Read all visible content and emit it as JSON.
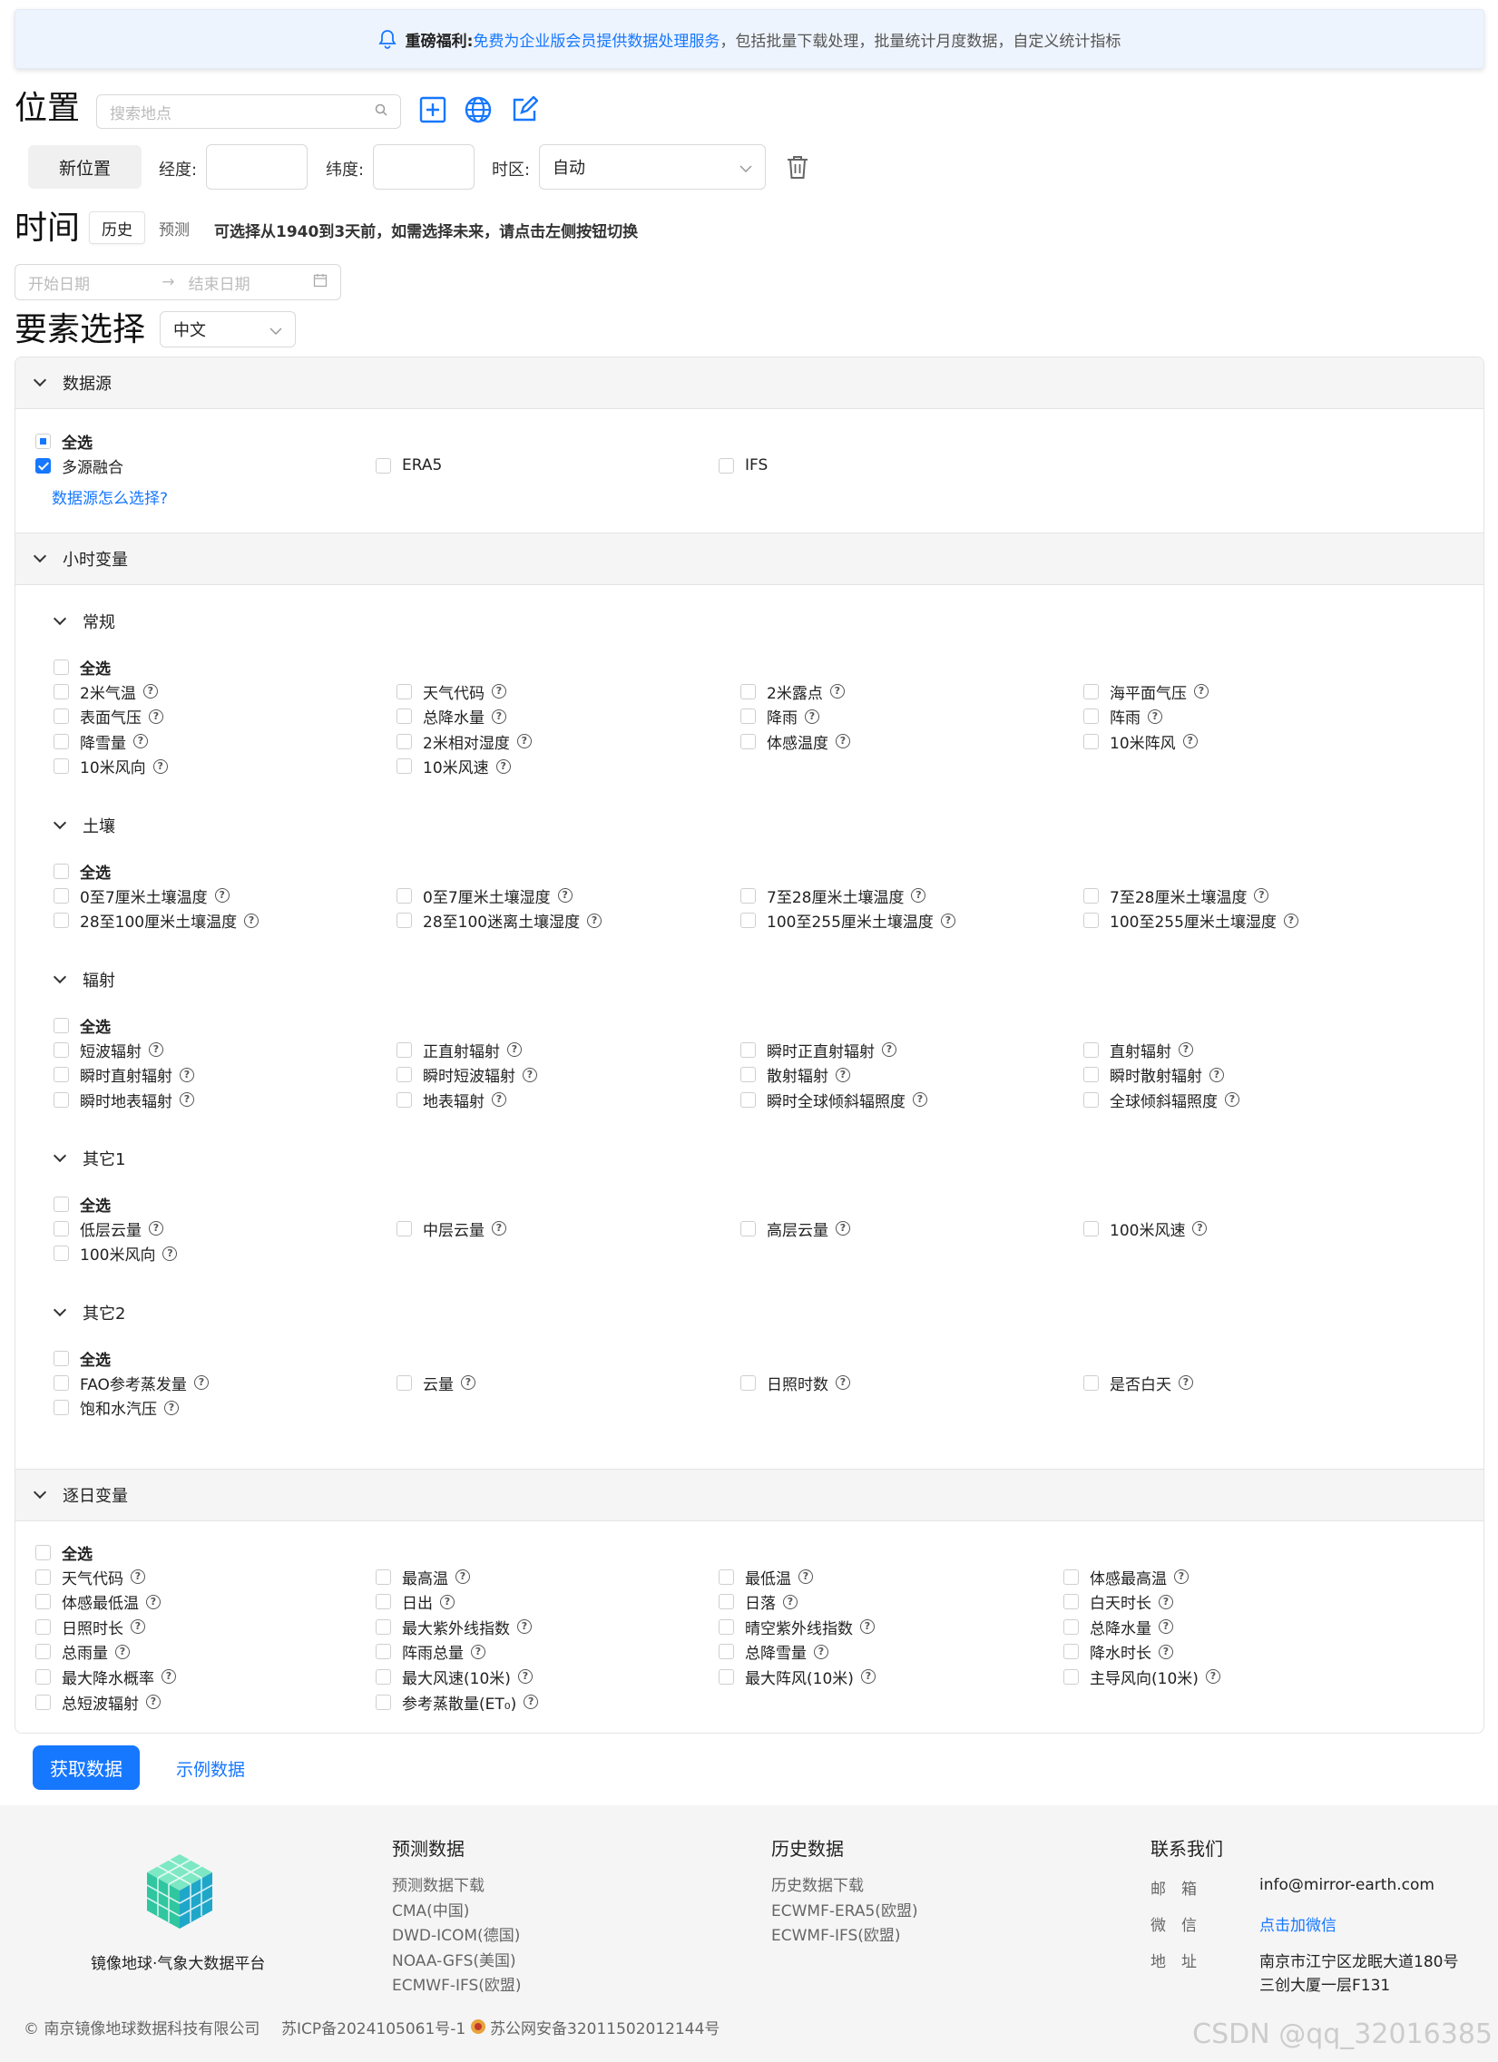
{
  "banner": {
    "prefix": "重磅福利:",
    "highlight": "免费为企业版会员提供数据处理服务",
    "suffix": "，包括批量下载处理，批量统计月度数据，自定义统计指标"
  },
  "location": {
    "title": "位置",
    "search_placeholder": "搜索地点",
    "new_location": "新位置",
    "lon_label": "经度:",
    "lat_label": "纬度:",
    "tz_label": "时区:",
    "tz_value": "自动"
  },
  "time": {
    "title": "时间",
    "tab_history": "历史",
    "tab_forecast": "预测",
    "tip": "可选择从1940到3天前，如需选择未来，请点击左侧按钮切换",
    "start_placeholder": "开始日期",
    "end_placeholder": "结束日期"
  },
  "elements": {
    "title": "要素选择",
    "lang": "中文"
  },
  "datasource": {
    "header": "数据源",
    "select_all": "全选",
    "items": [
      "多源融合",
      "ERA5",
      "IFS"
    ],
    "help_link": "数据源怎么选择?"
  },
  "hourly": {
    "header": "小时变量",
    "select_all": "全选",
    "groups": [
      {
        "title": "常规",
        "items": [
          "2米气温",
          "天气代码",
          "2米露点",
          "海平面气压",
          "表面气压",
          "总降水量",
          "降雨",
          "阵雨",
          "降雪量",
          "2米相对湿度",
          "体感温度",
          "10米阵风",
          "10米风向",
          "10米风速"
        ]
      },
      {
        "title": "土壤",
        "items": [
          "0至7厘米土壤温度",
          "0至7厘米土壤湿度",
          "7至28厘米土壤温度",
          "7至28厘米土壤温度",
          "28至100厘米土壤温度",
          "28至100迷离土壤湿度",
          "100至255厘米土壤温度",
          "100至255厘米土壤湿度"
        ]
      },
      {
        "title": "辐射",
        "items": [
          "短波辐射",
          "正直射辐射",
          "瞬时正直射辐射",
          "直射辐射",
          "瞬时直射辐射",
          "瞬时短波辐射",
          "散射辐射",
          "瞬时散射辐射",
          "瞬时地表辐射",
          "地表辐射",
          "瞬时全球倾斜辐照度",
          "全球倾斜辐照度"
        ]
      },
      {
        "title": "其它1",
        "items": [
          "低层云量",
          "中层云量",
          "高层云量",
          "100米风速",
          "100米风向"
        ]
      },
      {
        "title": "其它2",
        "items": [
          "FAO参考蒸发量",
          "云量",
          "日照时数",
          "是否白天",
          "饱和水汽压"
        ]
      }
    ]
  },
  "daily": {
    "header": "逐日变量",
    "select_all": "全选",
    "items": [
      "天气代码",
      "最高温",
      "最低温",
      "体感最高温",
      "体感最低温",
      "日出",
      "日落",
      "白天时长",
      "日照时长",
      "最大紫外线指数",
      "晴空紫外线指数",
      "总降水量",
      "总雨量",
      "阵雨总量",
      "总降雪量",
      "降水时长",
      "最大降水概率",
      "最大风速(10米)",
      "最大阵风(10米)",
      "主导风向(10米)",
      "总短波辐射",
      "参考蒸散量(ET₀)"
    ]
  },
  "actions": {
    "fetch": "获取数据",
    "sample": "示例数据"
  },
  "footer": {
    "brand": "镜像地球·气象大数据平台",
    "forecast": {
      "title": "预测数据",
      "links": [
        "预测数据下载",
        "CMA(中国)",
        "DWD-ICOM(德国)",
        "NOAA-GFS(美国)",
        "ECMWF-IFS(欧盟)"
      ]
    },
    "history": {
      "title": "历史数据",
      "links": [
        "历史数据下载",
        "ECWMF-ERA5(欧盟)",
        "ECWMF-IFS(欧盟)"
      ]
    },
    "contact": {
      "title": "联系我们",
      "email_label": "邮　箱",
      "email": "info@mirror-earth.com",
      "wechat_label": "微　信",
      "wechat": "点击加微信",
      "addr_label": "地　址",
      "addr1": "南京市江宁区龙眠大道180号",
      "addr2": "三创大厦一层F131"
    },
    "copyright": "© 南京镜像地球数据科技有限公司",
    "icp": "苏ICP备2024105061号-1",
    "police": "苏公网安备32011502012144号"
  },
  "watermark": "CSDN @qq_32016385",
  "colors": {
    "accent": "#1677ff"
  }
}
